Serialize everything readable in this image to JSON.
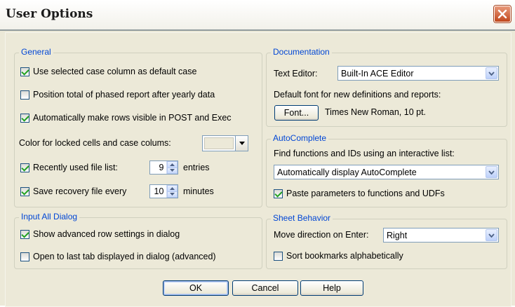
{
  "window": {
    "title": "User Options",
    "close_icon": "close-icon"
  },
  "general": {
    "legend": "General",
    "use_selected_case": {
      "label": "Use selected case column as default case",
      "checked": true
    },
    "position_total": {
      "label": "Position total of phased report after yearly data",
      "checked": false
    },
    "auto_rows_visible": {
      "label": "Automatically make rows visible in POST and Exec",
      "checked": true
    },
    "color_locked_label": "Color for locked cells and case colums:",
    "recent_files": {
      "label": "Recently used file list:",
      "checked": true,
      "value": "9",
      "unit": "entries"
    },
    "save_recovery": {
      "label": "Save recovery file every",
      "checked": true,
      "value": "10",
      "unit": "minutes"
    }
  },
  "input_all_dialog": {
    "legend": "Input All Dialog",
    "show_advanced": {
      "label": "Show advanced row settings in dialog",
      "checked": true
    },
    "open_last_tab": {
      "label": "Open to last tab displayed in dialog (advanced)",
      "checked": false
    }
  },
  "documentation": {
    "legend": "Documentation",
    "text_editor_label": "Text Editor:",
    "text_editor_value": "Built-In ACE Editor",
    "default_font_label": "Default font for new definitions and reports:",
    "font_button": "Font...",
    "font_value": "Times New Roman, 10 pt."
  },
  "autocomplete": {
    "legend": "AutoComplete",
    "find_label": "Find functions and IDs using an interactive list:",
    "mode_value": "Automatically display AutoComplete",
    "paste_params": {
      "label": "Paste parameters to functions and UDFs",
      "checked": true
    }
  },
  "sheet_behavior": {
    "legend": "Sheet Behavior",
    "move_direction_label": "Move direction on Enter:",
    "move_direction_value": "Right",
    "sort_bookmarks": {
      "label": "Sort bookmarks alphabetically",
      "checked": false
    }
  },
  "buttons": {
    "ok": "OK",
    "cancel": "Cancel",
    "help": "Help"
  }
}
